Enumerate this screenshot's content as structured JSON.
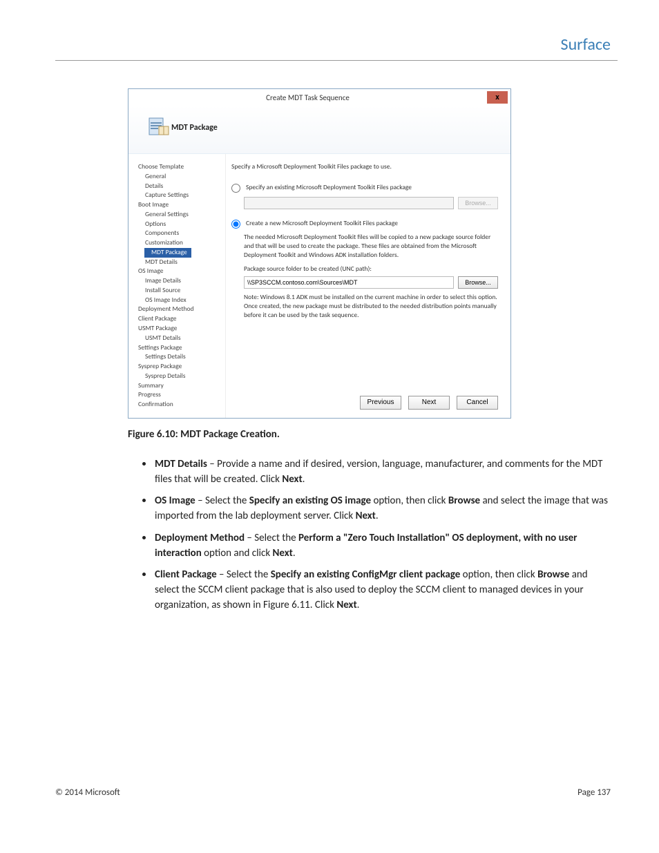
{
  "brand": "Surface",
  "dialog": {
    "title": "Create MDT Task Sequence",
    "header_title": "MDT Package",
    "close_glyph": "x",
    "sidebar": {
      "items": [
        {
          "label": "Choose Template",
          "indent": 0
        },
        {
          "label": "General",
          "indent": 1
        },
        {
          "label": "Details",
          "indent": 1
        },
        {
          "label": "Capture Settings",
          "indent": 1
        },
        {
          "label": "Boot Image",
          "indent": 0
        },
        {
          "label": "General Settings",
          "indent": 1
        },
        {
          "label": "Options",
          "indent": 1
        },
        {
          "label": "Components",
          "indent": 1
        },
        {
          "label": "Customization",
          "indent": 1
        },
        {
          "label": "MDT Package",
          "indent": 1,
          "selected": true
        },
        {
          "label": "MDT Details",
          "indent": 1
        },
        {
          "label": "OS Image",
          "indent": 0
        },
        {
          "label": "Image Details",
          "indent": 1
        },
        {
          "label": "Install Source",
          "indent": 1
        },
        {
          "label": "OS Image Index",
          "indent": 1
        },
        {
          "label": "Deployment Method",
          "indent": 0
        },
        {
          "label": "Client Package",
          "indent": 0
        },
        {
          "label": "USMT Package",
          "indent": 0
        },
        {
          "label": "USMT Details",
          "indent": 1
        },
        {
          "label": "Settings Package",
          "indent": 0
        },
        {
          "label": "Settings Details",
          "indent": 1
        },
        {
          "label": "Sysprep Package",
          "indent": 0
        },
        {
          "label": "Sysprep Details",
          "indent": 1
        },
        {
          "label": "Summary",
          "indent": 0
        },
        {
          "label": "Progress",
          "indent": 0
        },
        {
          "label": "Confirmation",
          "indent": 0
        }
      ]
    },
    "content": {
      "intro": "Specify a Microsoft Deployment Toolkit Files package to use.",
      "radio_existing": "Specify an existing Microsoft Deployment Toolkit Files package",
      "browse1": "Browse...",
      "radio_create": "Create a new Microsoft Deployment Toolkit Files package",
      "create_desc": "The needed Microsoft Deployment Toolkit files will be copied to a new package source folder and that will be used to create the package.  These files are obtained from the Microsoft Deployment Toolkit and Windows ADK installation folders.",
      "path_label": "Package source folder to be created (UNC path):",
      "path_value": "\\\\SP3SCCM.contoso.com\\Sources\\MDT",
      "browse2": "Browse...",
      "path_note": "Note: Windows 8.1 ADK must be installed on the current machine in order to select this option.  Once created, the new package must be distributed to the needed distribution points manually before it can be used by the task sequence."
    },
    "buttons": {
      "previous": "Previous",
      "next": "Next",
      "cancel": "Cancel"
    }
  },
  "caption": "Figure 6.10: MDT Package Creation.",
  "bullets": {
    "b1": {
      "strong": "MDT Details",
      "text": " – Provide a name and if desired, version, language, manufacturer, and comments for the MDT files that will be created. Click ",
      "strong2": "Next",
      "tail": "."
    },
    "b2": {
      "strong": "OS Image",
      "t1": " – Select the ",
      "strong2": "Specify an existing OS image",
      "t2": " option, then click ",
      "strong3": "Browse",
      "t3": " and select the image that was imported from the lab deployment server. Click ",
      "strong4": "Next",
      "tail": "."
    },
    "b3": {
      "strong": "Deployment Method",
      "t1": " – Select the ",
      "strong2": "Perform a \"Zero Touch Installation\" OS deployment, with no user interaction",
      "t2": " option and click ",
      "strong3": "Next",
      "tail": "."
    },
    "b4": {
      "strong": "Client Package",
      "t1": " – Select the ",
      "strong2": "Specify an existing ConfigMgr client package",
      "t2": " option, then click ",
      "strong3": "Browse",
      "t3": " and select the SCCM client package that is also used to deploy the SCCM client to managed devices in your organization, as shown in Figure 6.11. Click ",
      "strong4": "Next",
      "tail": "."
    }
  },
  "footer": {
    "copyright": "© 2014 Microsoft",
    "page": "Page 137"
  }
}
